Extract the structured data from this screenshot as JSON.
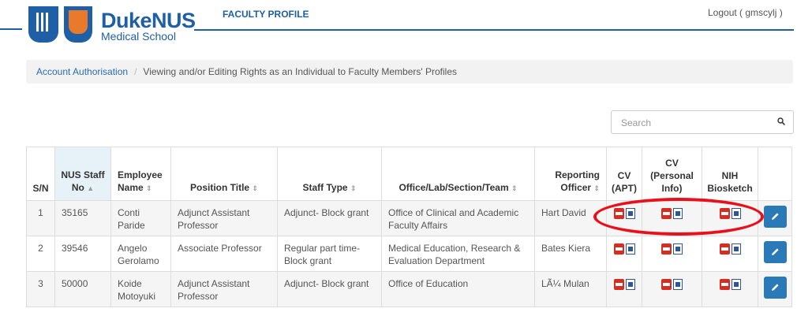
{
  "header": {
    "logo_main": "DukeNUS",
    "logo_sub": "Medical School",
    "app_title": "FACULTY PROFILE",
    "logout": "Logout ( gmscylj )"
  },
  "breadcrumb": {
    "link": "Account Authorisation",
    "separator": "/",
    "current": "Viewing and/or Editing Rights as an Individual to Faculty Members' Profiles"
  },
  "search": {
    "placeholder": "Search"
  },
  "table": {
    "headers": {
      "sn": "S/N",
      "staff_no_1": "NUS Staff",
      "staff_no_2": "No",
      "name_1": "Employee",
      "name_2": "Name",
      "position": "Position Title",
      "staff_type": "Staff Type",
      "office": "Office/Lab/Section/Team",
      "officer_1": "Reporting",
      "officer_2": "Officer",
      "cv_apt_1": "CV",
      "cv_apt_2": "(APT)",
      "cv_personal_1": "CV",
      "cv_personal_2": "(Personal",
      "cv_personal_3": "Info)",
      "nih_1": "NIH",
      "nih_2": "Biosketch"
    },
    "sort_icons": {
      "asc": "▲",
      "both": "⇕"
    },
    "rows": [
      {
        "sn": "1",
        "staff_no": "35165",
        "name_1": "Conti",
        "name_2": "Paride",
        "position_1": "Adjunct Assistant",
        "position_2": "Professor",
        "staff_type_1": "Adjunct- Block grant",
        "staff_type_2": "",
        "office_1": "Office of Clinical and Academic",
        "office_2": "Faculty Affairs",
        "officer": "Hart David"
      },
      {
        "sn": "2",
        "staff_no": "39546",
        "name_1": "Angelo",
        "name_2": "Gerolamo",
        "position_1": "Associate Professor",
        "position_2": "",
        "staff_type_1": "Regular part time-",
        "staff_type_2": "Block grant",
        "office_1": "Medical Education, Research &",
        "office_2": "Evaluation Department",
        "officer": "Bates Kiera"
      },
      {
        "sn": "3",
        "staff_no": "50000",
        "name_1": "Koide",
        "name_2": "Motoyuki",
        "position_1": "Adjunct Assistant",
        "position_2": "Professor",
        "staff_type_1": "Adjunct- Block grant",
        "staff_type_2": "",
        "office_1": "Office of Education",
        "office_2": "",
        "officer": "LÃ¼ Mulan"
      }
    ]
  },
  "colors": {
    "brand": "#1f5fa5",
    "accent_orange": "#e9792b",
    "edit_button": "#2a7ab8",
    "highlight": "#e8101a"
  },
  "icons": [
    "search-icon",
    "pdf-icon",
    "word-icon",
    "pencil-icon"
  ]
}
